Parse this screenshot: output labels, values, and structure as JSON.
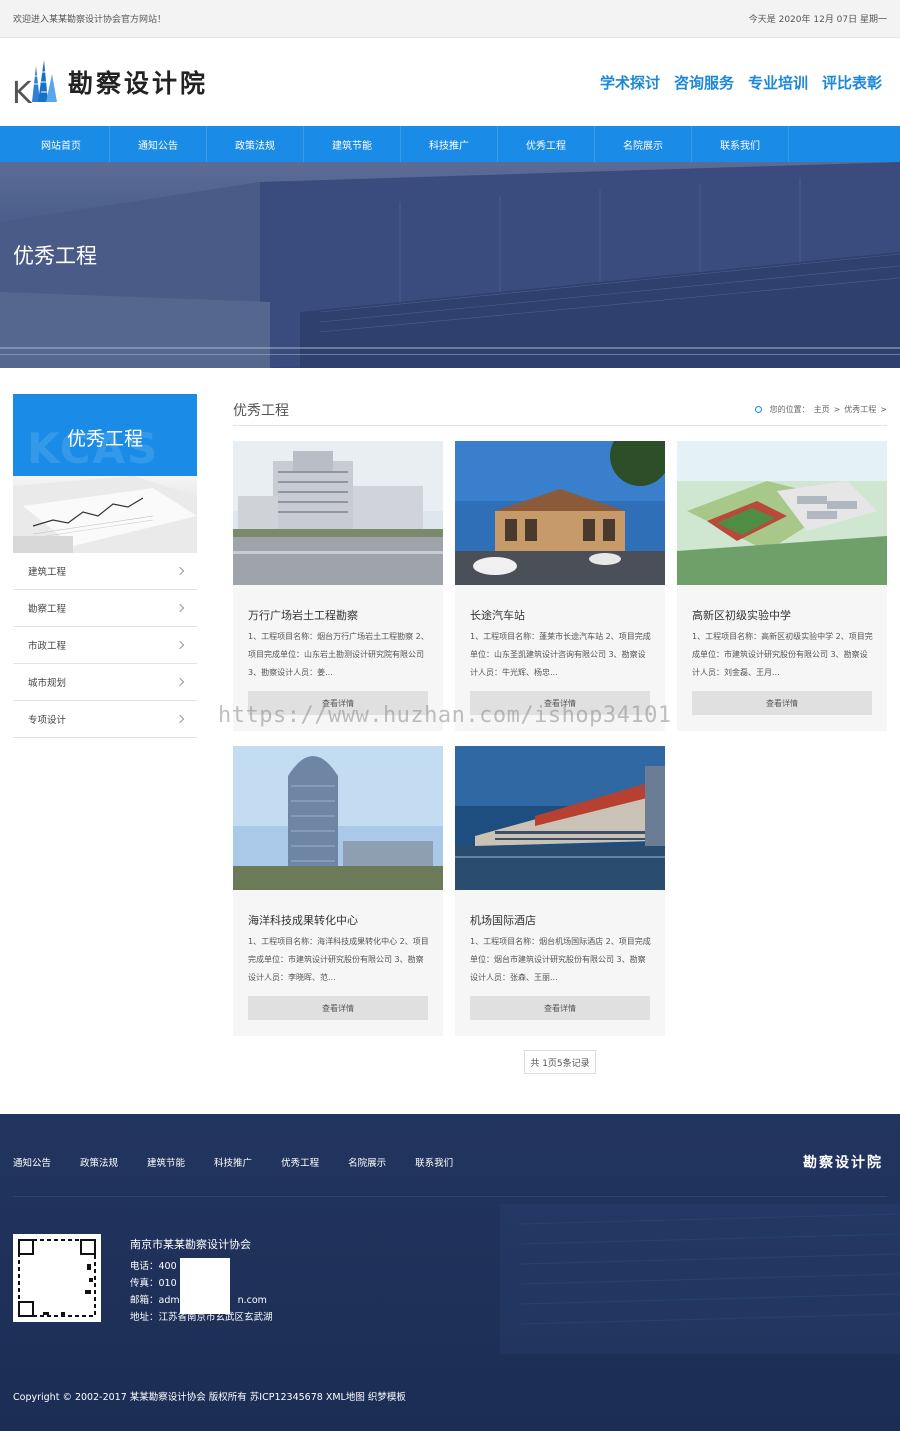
{
  "topbar": {
    "welcome": "欢迎进入某某勘察设计协会官方网站！",
    "date": "今天是 2020年 12月 07日 星期一"
  },
  "header": {
    "logo_letter": "K",
    "site_name": "勘察设计院",
    "links": [
      "学术探讨",
      "咨询服务",
      "专业培训",
      "评比表彰"
    ]
  },
  "nav": [
    "网站首页",
    "通知公告",
    "政策法规",
    "建筑节能",
    "科技推广",
    "优秀工程",
    "名院展示",
    "联系我们"
  ],
  "banner": {
    "title": "优秀工程"
  },
  "sidebar": {
    "title": "优秀工程",
    "bg_text": "KCAS",
    "items": [
      "建筑工程",
      "勘察工程",
      "市政工程",
      "城市规划",
      "专项设计"
    ]
  },
  "content": {
    "title": "优秀工程",
    "breadcrumb": {
      "label": "您的位置：",
      "home": "主页",
      "sep": ">",
      "current": "优秀工程"
    }
  },
  "projects": [
    {
      "name": "万行广场岩土工程勘察",
      "desc": "1、工程项目名称：烟台万行广场岩土工程勘察 2、项目完成单位：山东岩土勘测设计研究院有限公司 3、勘察设计人员：姜...",
      "button": "查看详情"
    },
    {
      "name": "长途汽车站",
      "desc": "1、工程项目名称：蓬莱市长途汽车站 2、项目完成单位：山东圣凯建筑设计咨询有限公司 3、勘察设计人员：牛光辉、杨忠...",
      "button": "查看详情"
    },
    {
      "name": "高新区初级实验中学",
      "desc": "1、工程项目名称：高新区初级实验中学 2、项目完成单位：市建筑设计研究股份有限公司 3、勘察设计人员：刘金磊、王月...",
      "button": "查看详情"
    },
    {
      "name": "海洋科技成果转化中心",
      "desc": "1、工程项目名称：海洋科技成果转化中心 2、项目完成单位：市建筑设计研究股份有限公司 3、勘察设计人员：李晓晖、范...",
      "button": "查看详情"
    },
    {
      "name": "机场国际酒店",
      "desc": "1、工程项目名称：烟台机场国际酒店 2、项目完成单位：烟台市建筑设计研究股份有限公司 3、勘察设计人员：张森、王丽...",
      "button": "查看详情"
    }
  ],
  "pager": "共 1页5条记录",
  "watermark": "https://www.huzhan.com/ishop34101",
  "footer": {
    "nav": [
      "通知公告",
      "政策法规",
      "建筑节能",
      "科技推广",
      "优秀工程",
      "名院展示",
      "联系我们"
    ],
    "logo": "勘察设计院",
    "org": "南京市某某勘察设计协会",
    "phone": "电话：400",
    "fax": "传真：010",
    "email_start": "邮箱：adm",
    "email_end": "n.com",
    "address": "地址：江苏省南京市玄武区玄武湖",
    "copyright": "Copyright © 2002-2017 某某勘察设计协会 版权所有 苏ICP12345678 XML地图 织梦模板"
  }
}
